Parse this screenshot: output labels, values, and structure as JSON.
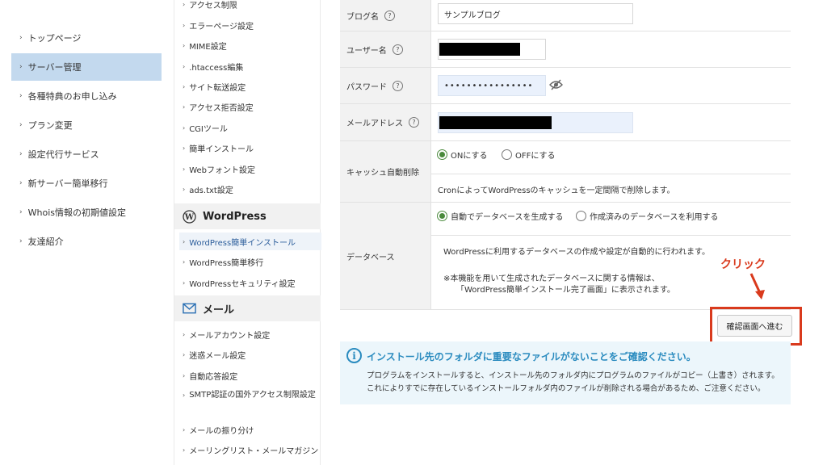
{
  "left_nav": [
    {
      "label": "トップページ",
      "active": false
    },
    {
      "label": "サーバー管理",
      "active": true
    },
    {
      "label": "各種特典のお申し込み",
      "active": false
    },
    {
      "label": "プラン変更",
      "active": false
    },
    {
      "label": "設定代行サービス",
      "active": false
    },
    {
      "label": "新サーバー簡単移行",
      "active": false
    },
    {
      "label": "Whois情報の初期値設定",
      "active": false
    },
    {
      "label": "友達紹介",
      "active": false
    }
  ],
  "mid_nav": {
    "server_items": [
      "アクセス制限",
      "エラーページ設定",
      "MIME設定",
      ".htaccess編集",
      "サイト転送設定",
      "アクセス拒否設定",
      "CGIツール",
      "簡単インストール",
      "Webフォント設定",
      "ads.txt設定"
    ],
    "wordpress_heading": "WordPress",
    "wordpress_items": [
      "WordPress簡単インストール",
      "WordPress簡単移行",
      "WordPressセキュリティ設定"
    ],
    "mail_heading": "メール",
    "mail_items": [
      "メールアカウント設定",
      "迷惑メール設定",
      "自動応答設定",
      "SMTP認証の国外アクセス制限設定",
      "メールの振り分け",
      "メーリングリスト・メールマガジン"
    ]
  },
  "form": {
    "blog_name_label": "ブログ名",
    "blog_name_value": "サンプルブログ",
    "username_label": "ユーザー名",
    "password_label": "パスワード",
    "password_value": "••••••••••••••••",
    "email_label": "メールアドレス",
    "cache_label": "キャッシュ自動削除",
    "cache_on": "ONにする",
    "cache_off": "OFFにする",
    "cache_note": "CronによってWordPressのキャッシュを一定間隔で削除します。",
    "db_label": "データベース",
    "db_auto": "自動でデータベースを生成する",
    "db_existing": "作成済みのデータベースを利用する",
    "db_note1": "WordPressに利用するデータベースの作成や設定が自動的に行われます。",
    "db_note2": "※本機能を用いて生成されたデータベースに関する情報は、",
    "db_note3": "「WordPress簡単インストール完了画面」に表示されます。",
    "help_glyph": "?"
  },
  "confirm_button": "確認画面へ進む",
  "annotation": {
    "label": "クリック",
    "color": "#d93a1d"
  },
  "info": {
    "icon_glyph": "i",
    "title": "インストール先のフォルダに重要なファイルがないことをご確認ください。",
    "line1": "プログラムをインストールすると、インストール先のフォルダ内にプログラムのファイルがコピー（上書き）されます。",
    "line2": "これによりすでに存在しているインストールフォルダ内のファイルが削除される場合があるため、ご注意ください。"
  },
  "icons": {
    "chevron": "chevron-right-icon",
    "wordpress": "wordpress-icon",
    "mail": "mail-icon",
    "eye_off": "eye-off-icon",
    "help": "help-circle-icon",
    "info": "info-circle-icon",
    "arrow": "arrow-down-icon"
  },
  "colors": {
    "active_nav_bg": "#c3d9ee",
    "accent_red": "#d93a1d",
    "info_blue": "#2a8bbf",
    "radio_green": "#4a8a3c"
  }
}
